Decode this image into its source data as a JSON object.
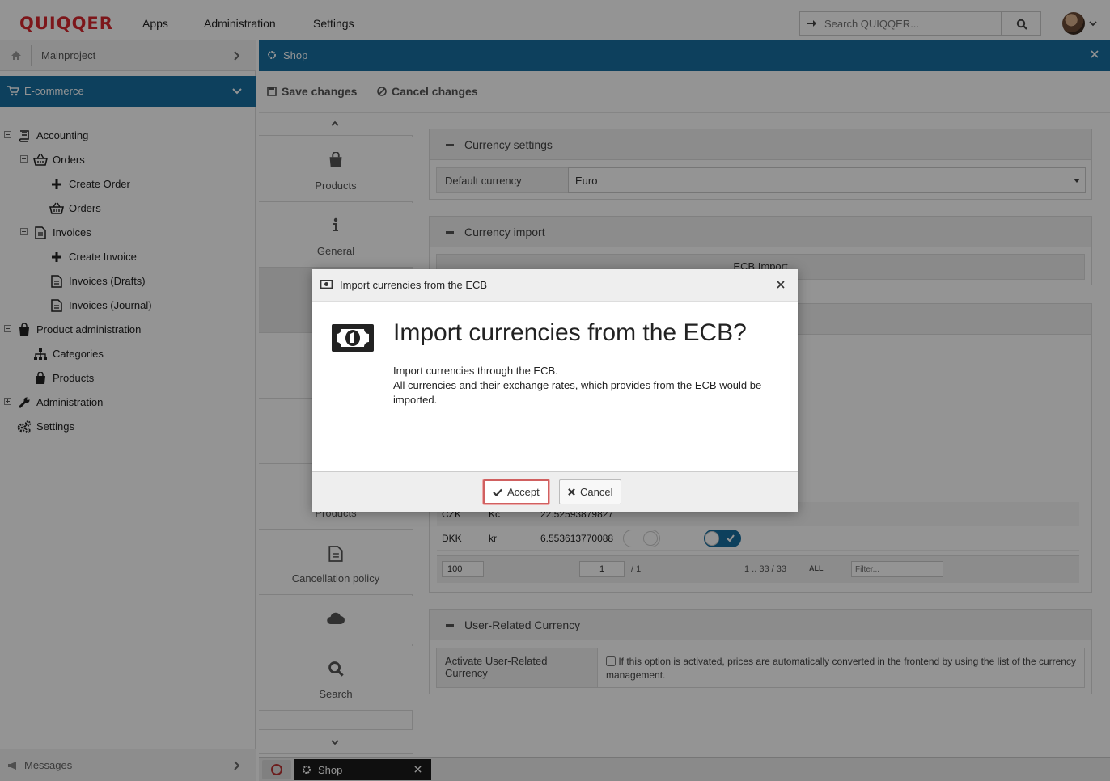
{
  "topbar": {
    "logo": "QUIQQER",
    "menu": [
      "Apps",
      "Administration",
      "Settings"
    ],
    "search_placeholder": "Search QUIQQER..."
  },
  "left": {
    "project": "Mainproject",
    "category": "E-commerce",
    "tree": [
      {
        "label": "Accounting"
      },
      {
        "label": "Orders"
      },
      {
        "label": "Create Order"
      },
      {
        "label": "Orders"
      },
      {
        "label": "Invoices"
      },
      {
        "label": "Create Invoice"
      },
      {
        "label": "Invoices (Drafts)"
      },
      {
        "label": "Invoices (Journal)"
      },
      {
        "label": "Product administration"
      },
      {
        "label": "Categories"
      },
      {
        "label": "Products"
      },
      {
        "label": "Administration"
      },
      {
        "label": "Settings"
      }
    ],
    "messages": "Messages"
  },
  "panel": {
    "title": "Shop",
    "save": "Save changes",
    "cancel": "Cancel changes",
    "tabs": [
      "Products",
      "General",
      "",
      "",
      "",
      "Products",
      "Cancellation policy",
      "",
      "Search"
    ],
    "currency_settings": {
      "title": "Currency settings",
      "default_label": "Default currency",
      "default_value": "Euro"
    },
    "currency_import": {
      "title": "Currency import",
      "button": "ECB Import"
    },
    "grid": {
      "rows": [
        {
          "code": "CZK",
          "sign": "Kč",
          "rate": "22.52593879827"
        },
        {
          "code": "DKK",
          "sign": "kr",
          "rate": "6.553613770088"
        }
      ],
      "per_page": "100",
      "page": "1",
      "of_pages": "/ 1",
      "range": "1 .. 33 / 33",
      "all_label": "ALL",
      "filter_placeholder": "Filter..."
    },
    "user_currency": {
      "title": "User-Related Currency",
      "label": "Activate User-Related Currency",
      "text": "If this option is activated, prices are automatically converted in the frontend by using the list of the currency management."
    }
  },
  "taskbar": {
    "task": "Shop"
  },
  "dialog": {
    "header": "Import currencies from the ECB",
    "title": "Import currencies from the ECB?",
    "line1": "Import currencies through the ECB.",
    "line2": "All currencies and their exchange rates, which provides from the ECB would be imported.",
    "accept": "Accept",
    "cancel": "Cancel"
  },
  "colors": {
    "accent": "#176ea0",
    "logo": "#d8262e"
  }
}
